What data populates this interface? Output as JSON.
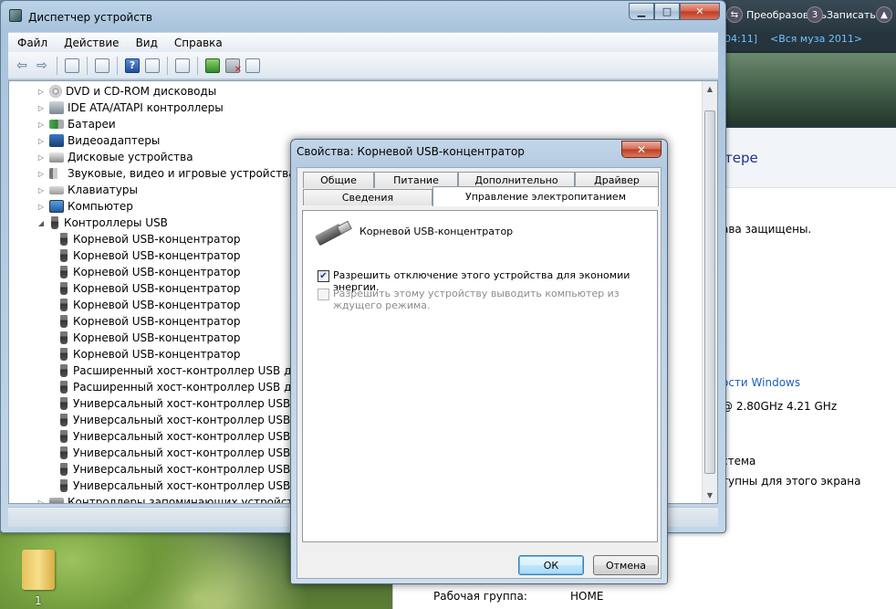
{
  "background": {
    "desktop_icon_label": "1",
    "media_bar": {
      "convert_label": "Преобразовать",
      "record_label": "Записать",
      "track_time": "04:11]",
      "track_title": "<Вся муза 2011>"
    },
    "system_panel": {
      "heading": "тере",
      "copyright": "ава защищены.",
      "windows_link": "ости Windows",
      "cpu": "@ 2.80GHz   4.21 GHz",
      "system_type": "стема",
      "pen_touch": "тупны для этого экрана",
      "workgroup_label": "Рабочая группа:",
      "workgroup_value": "HOME"
    }
  },
  "window": {
    "title": "Диспетчер устройств",
    "menu": [
      "Файл",
      "Действие",
      "Вид",
      "Справка"
    ],
    "tree": [
      {
        "label": "DVD и CD-ROM дисководы",
        "level": 1,
        "icon": "disc-icon",
        "expanded": false
      },
      {
        "label": "IDE ATA/ATAPI контроллеры",
        "level": 1,
        "icon": "ide-controller-icon",
        "expanded": false
      },
      {
        "label": "Батареи",
        "level": 1,
        "icon": "battery-icon",
        "expanded": false
      },
      {
        "label": "Видеоадаптеры",
        "level": 1,
        "icon": "display-adapter-icon",
        "expanded": false
      },
      {
        "label": "Дисковые устройства",
        "level": 1,
        "icon": "disk-drive-icon",
        "expanded": false
      },
      {
        "label": "Звуковые, видео и игровые устройства",
        "level": 1,
        "icon": "sound-icon",
        "expanded": false
      },
      {
        "label": "Клавиатуры",
        "level": 1,
        "icon": "keyboard-icon",
        "expanded": false
      },
      {
        "label": "Компьютер",
        "level": 1,
        "icon": "computer-icon",
        "expanded": false
      },
      {
        "label": "Контроллеры USB",
        "level": 1,
        "icon": "usb-icon",
        "expanded": true
      },
      {
        "label": "Корневой USB-концентратор",
        "level": 2,
        "icon": "usb-icon"
      },
      {
        "label": "Корневой USB-концентратор",
        "level": 2,
        "icon": "usb-icon"
      },
      {
        "label": "Корневой USB-концентратор",
        "level": 2,
        "icon": "usb-icon"
      },
      {
        "label": "Корневой USB-концентратор",
        "level": 2,
        "icon": "usb-icon"
      },
      {
        "label": "Корневой USB-концентратор",
        "level": 2,
        "icon": "usb-icon"
      },
      {
        "label": "Корневой USB-концентратор",
        "level": 2,
        "icon": "usb-icon"
      },
      {
        "label": "Корневой USB-концентратор",
        "level": 2,
        "icon": "usb-icon"
      },
      {
        "label": "Корневой USB-концентратор",
        "level": 2,
        "icon": "usb-icon"
      },
      {
        "label": "Расширенный хост-контроллер USB для",
        "level": 2,
        "icon": "usb-icon"
      },
      {
        "label": "Расширенный хост-контроллер USB для",
        "level": 2,
        "icon": "usb-icon"
      },
      {
        "label": "Универсальный хост-контроллер USB дл",
        "level": 2,
        "icon": "usb-icon"
      },
      {
        "label": "Универсальный хост-контроллер USB дл",
        "level": 2,
        "icon": "usb-icon"
      },
      {
        "label": "Универсальный хост-контроллер USB дл",
        "level": 2,
        "icon": "usb-icon"
      },
      {
        "label": "Универсальный хост-контроллер USB дл",
        "level": 2,
        "icon": "usb-icon"
      },
      {
        "label": "Универсальный хост-контроллер USB дл",
        "level": 2,
        "icon": "usb-icon"
      },
      {
        "label": "Универсальный хост-контроллер USB дл",
        "level": 2,
        "icon": "usb-icon"
      },
      {
        "label": "Контроллеры запоминающих устройств",
        "level": 1,
        "icon": "storage-controller-icon",
        "expanded": false
      }
    ]
  },
  "dialog": {
    "title": "Свойства: Корневой USB-концентратор",
    "tabs_row1": [
      "Общие",
      "Питание",
      "Дополнительно",
      "Драйвер"
    ],
    "tabs_row2": [
      "Сведения",
      "Управление электропитанием"
    ],
    "active_tab": "Управление электропитанием",
    "device_name": "Корневой USB-концентратор",
    "allow_power_off_label": "Разрешить отключение этого устройства для экономии энергии.",
    "allow_power_off_checked": true,
    "allow_wake_label": "Разрешить этому устройству выводить компьютер из ждущего режима.",
    "allow_wake_checked": false,
    "allow_wake_enabled": false,
    "ok_label": "ОК",
    "cancel_label": "Отмена",
    "check_mark": "✔"
  }
}
